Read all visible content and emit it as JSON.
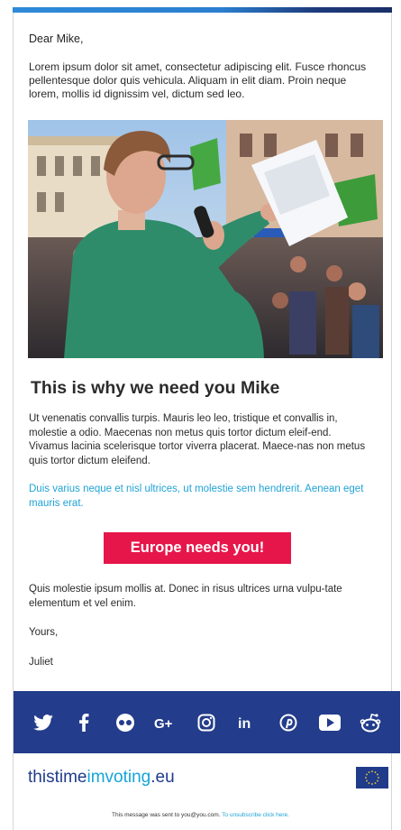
{
  "email": {
    "greeting": "Dear Mike,",
    "intro": "Lorem ipsum dolor sit amet, consectetur adipiscing elit. Fusce rhoncus pellentesque dolor quis vehicula. Aliquam in elit diam. Proin neque lorem, mollis id dignissim vel, dictum sed leo.",
    "headline": "This is why we need you Mike",
    "body1": "Ut venenatis convallis turpis. Mauris leo leo, tristique et convallis in, molestie a odio. Maecenas non metus quis tortor dictum eleif-end. Vivamus lacinia scelerisque tortor viverra placerat.  Maece-nas non metus quis tortor dictum eleifend.",
    "body_blue": "Duis varius neque et nisl ultrices, ut molestie sem hendrerit. Aenean eget mauris erat.",
    "cta_label": "Europe needs you!",
    "body2": "Quis molestie ipsum mollis at. Donec in risus ultrices urna vulpu-tate elementum et vel enim.",
    "closing": "Yours,",
    "signature": "Juliet"
  },
  "social_icons": [
    "twitter-icon",
    "facebook-icon",
    "flickr-icon",
    "google-plus-icon",
    "instagram-icon",
    "linkedin-icon",
    "pinterest-icon",
    "youtube-icon",
    "reddit-icon"
  ],
  "brand": {
    "part1": "thistime",
    "part2": "imvoting",
    "part3": ".eu"
  },
  "footer": {
    "sent_text": "This message was sent to you@you.com.",
    "unsubscribe_text": "To unsubscribe click here."
  },
  "colors": {
    "cta": "#e6164a",
    "social_bar": "#233c8b",
    "accent_blue": "#1fa3d6",
    "brand_navy": "#1f3b8a"
  }
}
